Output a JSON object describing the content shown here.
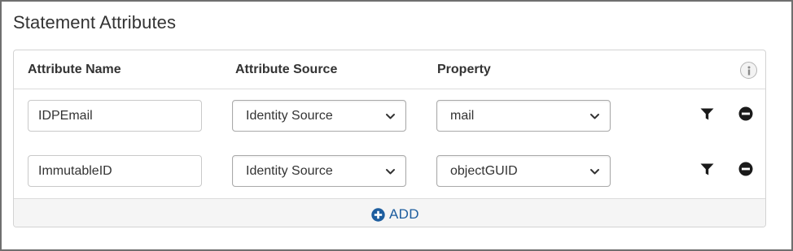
{
  "section": {
    "title": "Statement Attributes"
  },
  "table": {
    "headers": {
      "attribute_name": "Attribute Name",
      "attribute_source": "Attribute Source",
      "property": "Property"
    },
    "info_icon": "info-icon",
    "rows": [
      {
        "attribute_name": "IDPEmail",
        "attribute_source": "Identity Source",
        "property": "mail"
      },
      {
        "attribute_name": "ImmutableID",
        "attribute_source": "Identity Source",
        "property": "objectGUID"
      }
    ]
  },
  "footer": {
    "add_label": "ADD",
    "add_icon": "plus-circle-icon"
  },
  "icons": {
    "filter": "filter-icon",
    "remove": "minus-circle-icon",
    "dropdown": "chevron-down-icon"
  },
  "colors": {
    "accent": "#1d5d9e",
    "icon_dark": "#1a1a1a"
  }
}
